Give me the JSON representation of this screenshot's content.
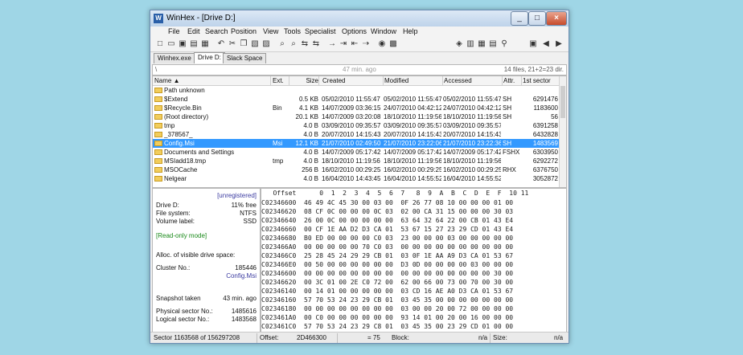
{
  "window": {
    "title": "WinHex - [Drive D:]"
  },
  "menu": [
    "File",
    "Edit",
    "Search",
    "Position",
    "View",
    "Tools",
    "Specialist",
    "Options",
    "Window",
    "Help"
  ],
  "tabs": [
    "Winhex.exe",
    "Drive D:",
    "Slack Space"
  ],
  "pathbar": {
    "path": "\\",
    "center": "47 min. ago",
    "right": "14 files, 21+2=23 dir."
  },
  "columns": {
    "name": "Name ▲",
    "ext": "Ext.",
    "size": "Size",
    "created": "Created",
    "modified": "Modified",
    "accessed": "Accessed",
    "attr": "Attr.",
    "sector": "1st sector"
  },
  "files": [
    {
      "name": "Path unknown",
      "ext": "",
      "size": "",
      "created": "",
      "modified": "",
      "accessed": "",
      "attr": "",
      "sector": ""
    },
    {
      "name": "$Extend",
      "ext": "",
      "size": "0.5 KB",
      "created": "05/02/2010  11:55:47",
      "modified": "05/02/2010  11:55:47",
      "accessed": "05/02/2010  11:55:47",
      "attr": "SH",
      "sector": "6291476"
    },
    {
      "name": "$Recycle.Bin",
      "ext": "Bin",
      "size": "4.1 KB",
      "created": "14/07/2009  03:36:15",
      "modified": "24/07/2010  04:42:12",
      "accessed": "24/07/2010  04:42:12",
      "attr": "SH",
      "sector": "1183600"
    },
    {
      "name": "(Root directory)",
      "ext": "",
      "size": "20.1 KB",
      "created": "14/07/2009  03:20:08",
      "modified": "18/10/2010  11:19:56",
      "accessed": "18/10/2010  11:19:56",
      "attr": "SH",
      "sector": "56"
    },
    {
      "name": "tmp",
      "ext": "",
      "size": "4.0 B",
      "created": "03/09/2010  09:35:57",
      "modified": "03/09/2010  09:35:57",
      "accessed": "03/09/2010  09:35:57",
      "attr": "",
      "sector": "6391258"
    },
    {
      "name": "_378567_",
      "ext": "",
      "size": "4.0 B",
      "created": "20/07/2010  14:15:43",
      "modified": "20/07/2010  14:15:43",
      "accessed": "20/07/2010  14:15:43",
      "attr": "",
      "sector": "6432828"
    },
    {
      "name": "Config.Msi",
      "ext": "Msi",
      "size": "12.1 KB",
      "created": "21/07/2010  02:49:50",
      "modified": "21/07/2010  23:22:06",
      "accessed": "21/07/2010  23:22:36",
      "attr": "SH",
      "sector": "1483569"
    },
    {
      "name": "Documents and Settings",
      "ext": "",
      "size": "4.0 B",
      "created": "14/07/2009  05:17:42",
      "modified": "14/07/2009  05:17:42",
      "accessed": "14/07/2009  05:17:42",
      "attr": "FSHX",
      "sector": "6303950"
    },
    {
      "name": "MSIadd18.tmp",
      "ext": "tmp",
      "size": "4.0 B",
      "created": "18/10/2010  11:19:56",
      "modified": "18/10/2010  11:19:56",
      "accessed": "18/10/2010  11:19:56",
      "attr": "",
      "sector": "6292272"
    },
    {
      "name": "MSOCache",
      "ext": "",
      "size": "256 B",
      "created": "16/02/2010  00:29:25",
      "modified": "16/02/2010  00:29:25",
      "accessed": "16/02/2010  00:29:25",
      "attr": "RHX",
      "sector": "6376750"
    },
    {
      "name": "Nelgear",
      "ext": "",
      "size": "4.0 B",
      "created": "16/04/2010  14:43:45",
      "modified": "16/04/2010  14:55:52",
      "accessed": "16/04/2010  14:55:52",
      "attr": "",
      "sector": "3052872"
    }
  ],
  "info": {
    "unregistered": "[unregistered]",
    "drive_label": "Drive D:",
    "drive_value": "11% free",
    "fs_label": "File system:",
    "fs_value": "NTFS",
    "vol_label": "Volume label:",
    "vol_value": "SSD",
    "mode": "[Read-only mode]",
    "alloc": "Alloc. of visible drive space:",
    "cluster_label": "Cluster No.:",
    "cluster_value": "185446",
    "cluster_file": "Config.Msi",
    "snapshot_label": "Snapshot taken",
    "snapshot_value": "43 min. ago",
    "phys_label": "Physical sector No.:",
    "phys_value": "1485616",
    "log_label": "Logical sector No.:",
    "log_value": "1483568"
  },
  "hex": {
    "header": "   Offset      0  1  2  3  4  5  6  7   8  9  A  B  C  D  E  F  10 11",
    "rows": [
      {
        "off": "C02346600",
        "bytes": "46 49 4C 45 30 00 03 00  0F 26 77 08 10 00 00 00 01 00"
      },
      {
        "off": "C02346620",
        "bytes": "08 CF 0C 00 00 00 0C 03  02 00 CA 31 15 00 00 00 30 03"
      },
      {
        "off": "C02346640",
        "bytes": "26 00 0C 00 00 00 00 00  63 64 32 64 22 00 CB 01 43 E4"
      },
      {
        "off": "C02346660",
        "bytes": "00 CF 1E AA D2 D3 CA 01  53 67 15 27 23 29 CD 01 43 E4"
      },
      {
        "off": "C02346680",
        "bytes": "B0 ED 00 00 00 00 C0 03  23 00 00 00 03 00 00 00 00 00"
      },
      {
        "off": "C023466A0",
        "bytes": "00 00 00 00 00 70 C0 03  00 00 00 00 00 00 00 00 00 00"
      },
      {
        "off": "C023466C0",
        "bytes": "25 28 45 24 29 29 CB 01  03 0F 1E AA A9 D3 CA 01 53 67"
      },
      {
        "off": "C023466E0",
        "bytes": "00 50 00 00 00 00 00 00  D3 0D 00 00 00 00 03 00 00 00"
      },
      {
        "off": "C02346600",
        "bytes": "00 00 00 00 00 00 00 00  00 00 00 00 00 00 00 00 30 00"
      },
      {
        "off": "C02346620",
        "bytes": "00 3C 01 00 2E C0 72 00  62 00 66 00 73 00 70 00 30 00"
      },
      {
        "off": "C02346140",
        "bytes": "00 14 01 00 00 00 00 00  03 CD 16 AE A0 D3 CA 01 53 67"
      },
      {
        "off": "C02346160",
        "bytes": "57 70 53 24 23 29 CB 01  03 45 35 00 00 00 00 00 00 00"
      },
      {
        "off": "C02346180",
        "bytes": "00 00 00 00 00 00 00 00  03 00 00 20 00 72 00 00 00 00"
      },
      {
        "off": "C023461A0",
        "bytes": "00 C0 00 00 00 00 00 00  93 14 01 00 20 00 16 00 00 00"
      },
      {
        "off": "C023461C0",
        "bytes": "57 70 53 24 23 29 C8 01  03 45 35 00 23 29 CD 01 00 00"
      }
    ]
  },
  "status": {
    "sector": "Sector 1163568 of 156297208",
    "offset_label": "Offset:",
    "offset_value": "2D466300",
    "eq": "= 75",
    "block_label": "Block:",
    "block_value": "n/a",
    "size_label": "Size:",
    "size_value": "n/a"
  }
}
